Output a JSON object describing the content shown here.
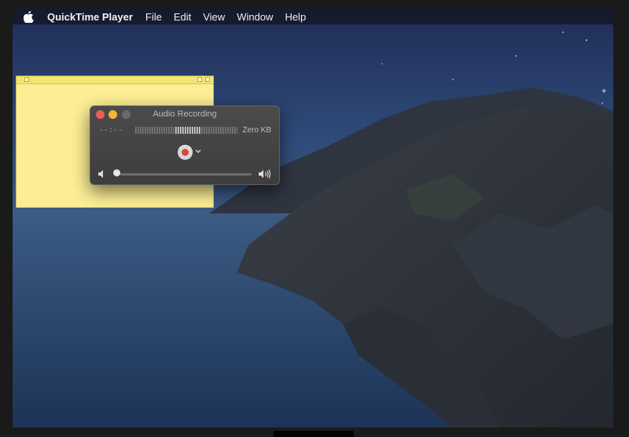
{
  "menubar": {
    "app_name": "QuickTime Player",
    "items": [
      "File",
      "Edit",
      "View",
      "Window",
      "Help"
    ]
  },
  "recording_panel": {
    "title": "Audio Recording",
    "elapsed_time": "--:--",
    "file_size": "Zero KB"
  },
  "colors": {
    "record": "#e0453d",
    "close": "#ee5c55",
    "minimize": "#f2b736",
    "zoom_disabled": "#6a6a6a",
    "sticky": "#fbee94"
  },
  "icons": {
    "menu_logo": "apple-icon",
    "record": "record-icon",
    "options": "chevron-down-icon",
    "volume_low": "speaker-low-icon",
    "volume_high": "speaker-high-icon"
  }
}
